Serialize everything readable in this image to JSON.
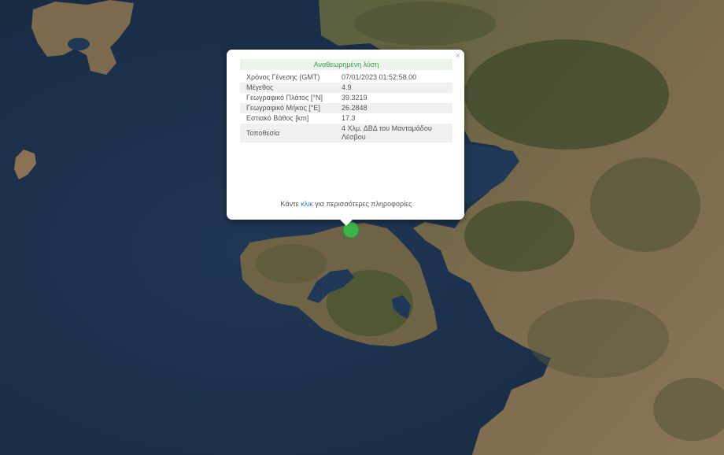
{
  "popup": {
    "title": "Αναθεωρημένη λύση",
    "close_symbol": "×",
    "rows": [
      {
        "label": "Χρόνος Γένεσης (GMT)",
        "value": "07/01/2023 01:52:58.00"
      },
      {
        "label": "Μέγεθος",
        "value": "4.9"
      },
      {
        "label": "Γεωγραφικό Πλάτος [°N]",
        "value": "39.3219"
      },
      {
        "label": "Γεωγραφικό Μήκος [°E]",
        "value": "26.2848"
      },
      {
        "label": "Εστιακό Βάθος [km]",
        "value": "17.3"
      },
      {
        "label": "Τοποθεσία",
        "value": "4 Χλμ. ΔΒΔ του Μανταμάδου Λέσβου"
      }
    ],
    "more_prefix": "Κάντε",
    "more_link": "κλικ",
    "more_suffix": "για περισσότερες πληροφορίες"
  },
  "colors": {
    "sea": "#1b2f49",
    "land": "#6d6045",
    "vegetation": "#3c4c2a",
    "marker": "#3bb54a",
    "title_green": "#3aa04a"
  },
  "icons": {
    "marker": "epicenter-marker-icon",
    "close": "close-icon"
  }
}
